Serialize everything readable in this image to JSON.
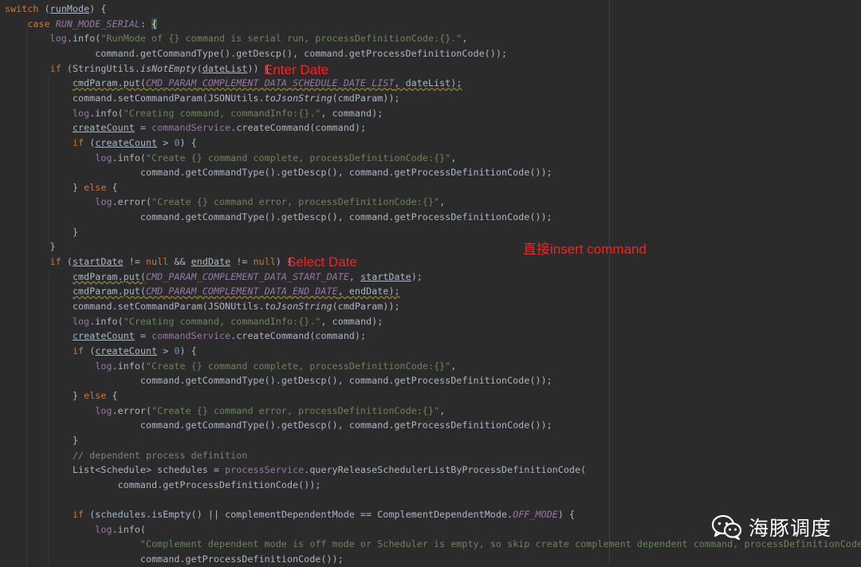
{
  "code_lines": [
    [
      {
        "t": "switch",
        "c": "kw"
      },
      {
        "t": " ("
      },
      {
        "t": "runMode",
        "c": "under"
      },
      {
        "t": ") {"
      }
    ],
    [
      {
        "t": "    "
      },
      {
        "t": "case",
        "c": "kw"
      },
      {
        "t": " "
      },
      {
        "t": "RUN_MODE_SERIAL",
        "c": "const"
      },
      {
        "t": ": "
      },
      {
        "t": "{",
        "c": "brace"
      }
    ],
    [
      {
        "t": "        "
      },
      {
        "t": "log",
        "c": "field"
      },
      {
        "t": ".info("
      },
      {
        "t": "\"RunMode of {} command is serial run, processDefinitionCode:{}.\"",
        "c": "str"
      },
      {
        "t": ","
      }
    ],
    [
      {
        "t": "                command.getCommandType().getDescp(), command.getProcessDefinitionCode());"
      }
    ],
    [
      {
        "t": "        "
      },
      {
        "t": "if",
        "c": "kw"
      },
      {
        "t": " (StringUtils."
      },
      {
        "t": "isNotEmpty",
        "c": "static"
      },
      {
        "t": "("
      },
      {
        "t": "dateList",
        "c": "under"
      },
      {
        "t": ")) {"
      }
    ],
    [
      {
        "t": "            "
      },
      {
        "t": "cmdParam.put(",
        "c": "warn"
      },
      {
        "t": "CMD_PARAM_COMPLEMENT_DATA_SCHEDULE_DATE_LIST",
        "c": "const warn"
      },
      {
        "t": ", dateList);",
        "c": "warn"
      }
    ],
    [
      {
        "t": "            command.setCommandParam(JSONUtils."
      },
      {
        "t": "toJsonString",
        "c": "static"
      },
      {
        "t": "(cmdParam));"
      }
    ],
    [
      {
        "t": "            "
      },
      {
        "t": "log",
        "c": "field"
      },
      {
        "t": ".info("
      },
      {
        "t": "\"Creating command, commandInfo:{}.\"",
        "c": "str"
      },
      {
        "t": ", command);"
      }
    ],
    [
      {
        "t": "            "
      },
      {
        "t": "createCount",
        "c": "under"
      },
      {
        "t": " = "
      },
      {
        "t": "commandService",
        "c": "field"
      },
      {
        "t": ".createCommand(command);"
      }
    ],
    [
      {
        "t": "            "
      },
      {
        "t": "if",
        "c": "kw"
      },
      {
        "t": " ("
      },
      {
        "t": "createCount",
        "c": "under"
      },
      {
        "t": " > "
      },
      {
        "t": "0",
        "c": "num"
      },
      {
        "t": ") {"
      }
    ],
    [
      {
        "t": "                "
      },
      {
        "t": "log",
        "c": "field"
      },
      {
        "t": ".info("
      },
      {
        "t": "\"Create {} command complete, processDefinitionCode:{}\"",
        "c": "str"
      },
      {
        "t": ","
      }
    ],
    [
      {
        "t": "                        command.getCommandType().getDescp(), command.getProcessDefinitionCode());"
      }
    ],
    [
      {
        "t": "            } "
      },
      {
        "t": "else",
        "c": "kw"
      },
      {
        "t": " {"
      }
    ],
    [
      {
        "t": "                "
      },
      {
        "t": "log",
        "c": "field"
      },
      {
        "t": ".error("
      },
      {
        "t": "\"Create {} command error, processDefinitionCode:{}\"",
        "c": "str"
      },
      {
        "t": ","
      }
    ],
    [
      {
        "t": "                        command.getCommandType().getDescp(), command.getProcessDefinitionCode());"
      }
    ],
    [
      {
        "t": "            }"
      }
    ],
    [
      {
        "t": "        }"
      }
    ],
    [
      {
        "t": "        "
      },
      {
        "t": "if",
        "c": "kw"
      },
      {
        "t": " ("
      },
      {
        "t": "startDate",
        "c": "under"
      },
      {
        "t": " != "
      },
      {
        "t": "null",
        "c": "kw"
      },
      {
        "t": " && "
      },
      {
        "t": "endDate",
        "c": "under"
      },
      {
        "t": " != "
      },
      {
        "t": "null",
        "c": "kw"
      },
      {
        "t": ") {"
      }
    ],
    [
      {
        "t": "            "
      },
      {
        "t": "cmdParam.put(",
        "c": "warn"
      },
      {
        "t": "CMD_PARAM_COMPLEMENT_DATA_START_DATE",
        "c": "const"
      },
      {
        "t": ", "
      },
      {
        "t": "startDate",
        "c": "under"
      },
      {
        "t": ");"
      }
    ],
    [
      {
        "t": "            "
      },
      {
        "t": "cmdParam.put(",
        "c": "warn"
      },
      {
        "t": "CMD_PARAM_COMPLEMENT_DATA_END_DATE",
        "c": "const warn"
      },
      {
        "t": ", endDate);",
        "c": "warn"
      }
    ],
    [
      {
        "t": "            command.setCommandParam(JSONUtils."
      },
      {
        "t": "toJsonString",
        "c": "static"
      },
      {
        "t": "(cmdParam));"
      }
    ],
    [
      {
        "t": "            "
      },
      {
        "t": "log",
        "c": "field"
      },
      {
        "t": ".info("
      },
      {
        "t": "\"Creating command, commandInfo:{}.\"",
        "c": "str"
      },
      {
        "t": ", command);"
      }
    ],
    [
      {
        "t": "            "
      },
      {
        "t": "createCount",
        "c": "under"
      },
      {
        "t": " = "
      },
      {
        "t": "commandService",
        "c": "field"
      },
      {
        "t": ".createCommand(command);"
      }
    ],
    [
      {
        "t": "            "
      },
      {
        "t": "if",
        "c": "kw"
      },
      {
        "t": " ("
      },
      {
        "t": "createCount",
        "c": "under"
      },
      {
        "t": " > "
      },
      {
        "t": "0",
        "c": "num"
      },
      {
        "t": ") {"
      }
    ],
    [
      {
        "t": "                "
      },
      {
        "t": "log",
        "c": "field"
      },
      {
        "t": ".info("
      },
      {
        "t": "\"Create {} command complete, processDefinitionCode:{}\"",
        "c": "str"
      },
      {
        "t": ","
      }
    ],
    [
      {
        "t": "                        command.getCommandType().getDescp(), command.getProcessDefinitionCode());"
      }
    ],
    [
      {
        "t": "            } "
      },
      {
        "t": "else",
        "c": "kw"
      },
      {
        "t": " {"
      }
    ],
    [
      {
        "t": "                "
      },
      {
        "t": "log",
        "c": "field"
      },
      {
        "t": ".error("
      },
      {
        "t": "\"Create {} command error, processDefinitionCode:{}\"",
        "c": "str"
      },
      {
        "t": ","
      }
    ],
    [
      {
        "t": "                        command.getCommandType().getDescp(), command.getProcessDefinitionCode());"
      }
    ],
    [
      {
        "t": "            }"
      }
    ],
    [
      {
        "t": "            "
      },
      {
        "t": "// dependent process definition",
        "c": "cmt"
      }
    ],
    [
      {
        "t": "            List<Schedule> schedules = "
      },
      {
        "t": "processService",
        "c": "field"
      },
      {
        "t": ".queryReleaseSchedulerListByProcessDefinitionCode("
      }
    ],
    [
      {
        "t": "                    command.getProcessDefinitionCode());"
      }
    ],
    [
      {
        "t": ""
      }
    ],
    [
      {
        "t": "            "
      },
      {
        "t": "if",
        "c": "kw"
      },
      {
        "t": " (schedules.isEmpty() || complementDependentMode == ComplementDependentMode."
      },
      {
        "t": "OFF_MODE",
        "c": "const"
      },
      {
        "t": ") {"
      }
    ],
    [
      {
        "t": "                "
      },
      {
        "t": "log",
        "c": "field"
      },
      {
        "t": ".info("
      }
    ],
    [
      {
        "t": "                        "
      },
      {
        "t": "\"Complement dependent mode is off mode or Scheduler is empty, so skip create complement dependent command, processDefinitionCode:{}.\"",
        "c": "str"
      },
      {
        "t": ","
      }
    ],
    [
      {
        "t": "                        command.getProcessDefinitionCode());"
      }
    ]
  ],
  "annotations": {
    "enter_date": "Enter Date",
    "select_date": "Select Date",
    "insert_command": "直接insert command"
  },
  "watermark": {
    "icon": "wechat-icon",
    "text": "海豚调度"
  },
  "colors": {
    "background": "#2b2b2b",
    "keyword": "#cc7832",
    "string": "#6a8759",
    "constant": "#9876aa",
    "number": "#6897bb",
    "comment": "#808080",
    "plain": "#a9b7c6",
    "annotation": "#ff1f1f"
  }
}
